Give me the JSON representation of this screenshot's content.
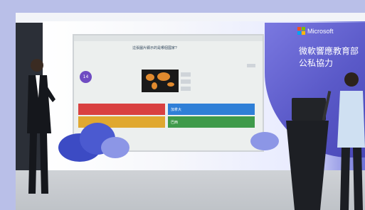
{
  "brand": {
    "name": "Microsoft"
  },
  "banner": {
    "line1": "微軟響應教育部",
    "line2": "公私協力"
  },
  "screen": {
    "question": "這張圖片顯示的是哪個國家?",
    "timer": "14",
    "answers": [
      "",
      "加拿大",
      "",
      "巴西"
    ]
  },
  "colors": {
    "brand_purple": "#5a59c8",
    "answer_red": "#d94040",
    "answer_blue": "#2f7fd7",
    "answer_yellow": "#e0a830",
    "answer_green": "#3f9a4a"
  }
}
